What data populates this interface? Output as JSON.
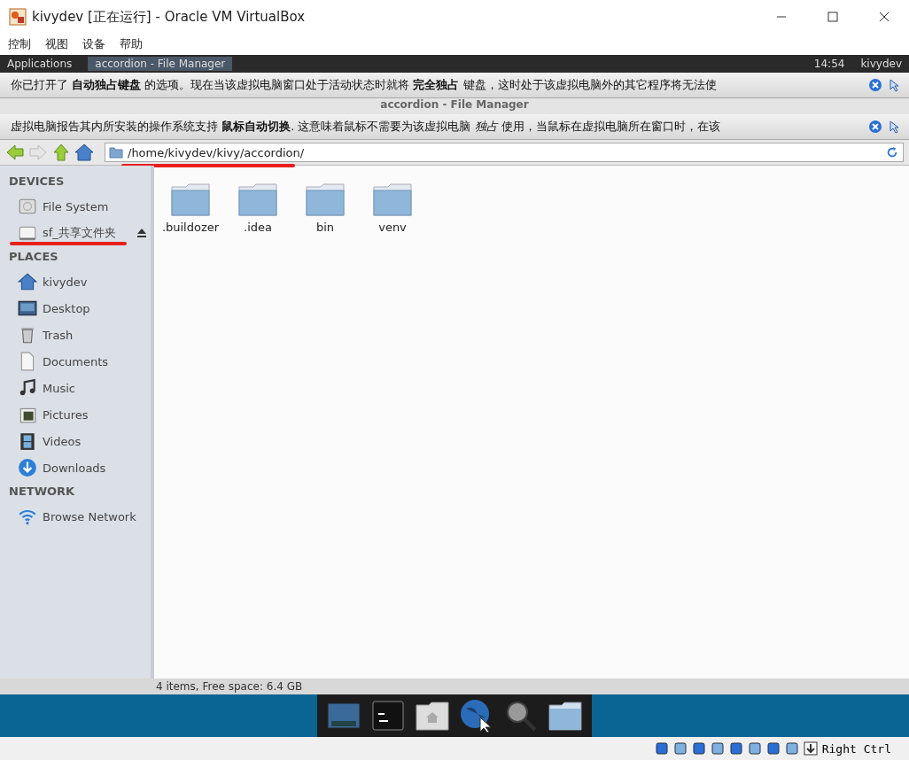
{
  "window": {
    "title": "kivydev [正在运行] - Oracle VM VirtualBox"
  },
  "menu": [
    "控制",
    "视图",
    "设备",
    "帮助"
  ],
  "panel": {
    "apps": "Applications",
    "task": "accordion - File Manager",
    "clock": "14:54",
    "user": "kivydev"
  },
  "notifications": [
    {
      "text": "你已打开了 **自动独占键盘** 的选项。现在当该虚拟电脑窗口处于活动状态时就将 **完全独占** 键盘，这时处于该虚拟电脑外的其它程序将无法使"
    },
    {
      "text": "虚拟电脑报告其内所安装的操作系统支持 **鼠标自动切换**. 这意味着鼠标不需要为该虚拟电脑 *独占* 使用，当鼠标在虚拟电脑所在窗口时，在该"
    }
  ],
  "file_manager": {
    "title": "accordion - File Manager",
    "path": "/home/kivydev/kivy/accordion/",
    "sidebar": [
      {
        "heading": "DEVICES",
        "items": [
          {
            "label": "File System",
            "kind": "disk",
            "eject": false
          },
          {
            "label": "sf_共享文件夹",
            "kind": "drive",
            "eject": true
          }
        ]
      },
      {
        "heading": "PLACES",
        "items": [
          {
            "label": "kivydev",
            "kind": "home",
            "eject": false
          },
          {
            "label": "Desktop",
            "kind": "desktop",
            "eject": false
          },
          {
            "label": "Trash",
            "kind": "trash",
            "eject": false
          },
          {
            "label": "Documents",
            "kind": "document",
            "eject": false
          },
          {
            "label": "Music",
            "kind": "music",
            "eject": false
          },
          {
            "label": "Pictures",
            "kind": "pictures",
            "eject": false
          },
          {
            "label": "Videos",
            "kind": "videos",
            "eject": false
          },
          {
            "label": "Downloads",
            "kind": "downloads",
            "eject": false
          }
        ]
      },
      {
        "heading": "NETWORK",
        "items": [
          {
            "label": "Browse Network",
            "kind": "network",
            "eject": false
          }
        ]
      }
    ],
    "files": [
      {
        "name": ".buildozer"
      },
      {
        "name": ".idea"
      },
      {
        "name": "bin"
      },
      {
        "name": "venv"
      }
    ],
    "status": "4 items, Free space: 6.4 GB"
  },
  "dock": [
    {
      "kind": "desktop"
    },
    {
      "kind": "terminal"
    },
    {
      "kind": "home"
    },
    {
      "kind": "browser"
    },
    {
      "kind": "search"
    },
    {
      "kind": "folder"
    }
  ],
  "host_key": "Right Ctrl"
}
